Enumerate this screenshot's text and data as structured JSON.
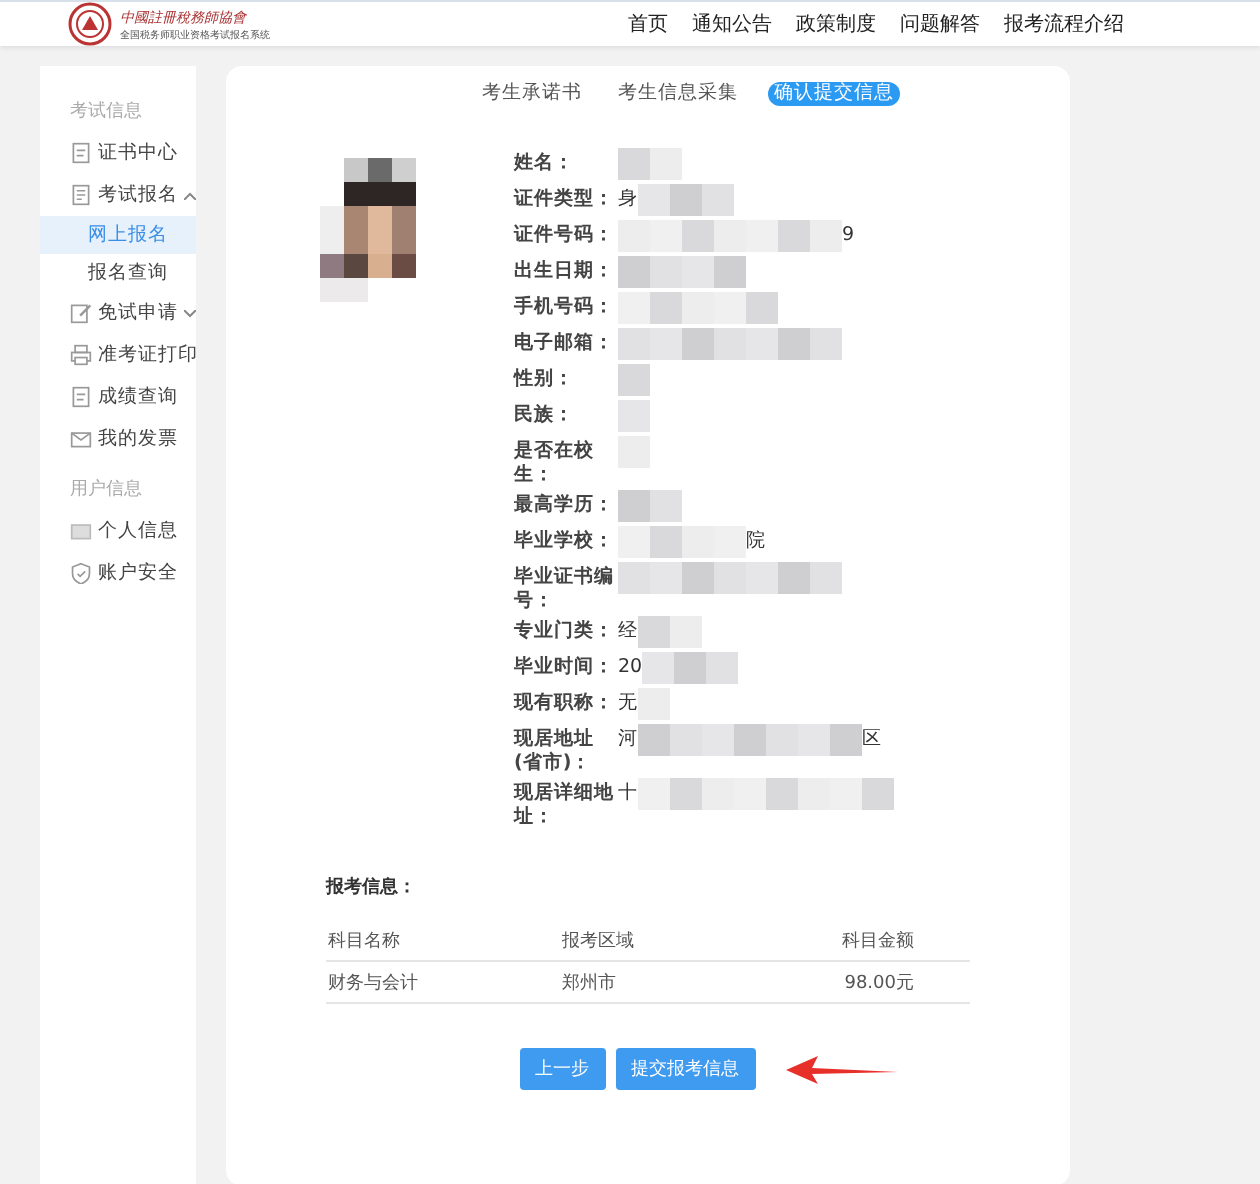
{
  "header": {
    "logo_title": "中國註冊稅務師協會",
    "logo_subtitle": "全国税务师职业资格考试报名系统",
    "nav": [
      {
        "label": "首页"
      },
      {
        "label": "通知公告"
      },
      {
        "label": "政策制度"
      },
      {
        "label": "问题解答"
      },
      {
        "label": "报考流程介绍"
      }
    ]
  },
  "sidebar": {
    "sections": [
      {
        "title": "考试信息",
        "items": [
          {
            "label": "证书中心"
          },
          {
            "label": "考试报名",
            "expanded": true,
            "children": [
              {
                "label": "网上报名",
                "selected": true
              },
              {
                "label": "报名查询",
                "selected": false
              }
            ]
          },
          {
            "label": "免试申请",
            "expanded": false
          },
          {
            "label": "准考证打印"
          },
          {
            "label": "成绩查询"
          },
          {
            "label": "我的发票"
          }
        ]
      },
      {
        "title": "用户信息",
        "items": [
          {
            "label": "个人信息"
          },
          {
            "label": "账户安全"
          }
        ]
      }
    ]
  },
  "steps": [
    {
      "label": "考生承诺书",
      "selected": false
    },
    {
      "label": "考生信息采集",
      "selected": false
    },
    {
      "label": "确认提交信息",
      "selected": true
    }
  ],
  "fields": [
    {
      "label": "姓名："
    },
    {
      "label": "证件类型：",
      "prefix": "身"
    },
    {
      "label": "证件号码：",
      "suffix": "9"
    },
    {
      "label": "出生日期："
    },
    {
      "label": "手机号码："
    },
    {
      "label": "电子邮箱："
    },
    {
      "label": "性别："
    },
    {
      "label": "民族："
    },
    {
      "label": "是否在校生："
    },
    {
      "label": "最高学历："
    },
    {
      "label": "毕业学校：",
      "suffix": "院"
    },
    {
      "label": "毕业证书编号："
    },
    {
      "label": "专业门类：",
      "prefix": "经"
    },
    {
      "label": "毕业时间：",
      "prefix": "20"
    },
    {
      "label": "现有职称：",
      "prefix": "无"
    },
    {
      "label": "现居地址(省市)：",
      "prefix": "河",
      "suffix": "区"
    },
    {
      "label": "现居详细地址：",
      "prefix": "十"
    }
  ],
  "exam": {
    "title": "报考信息：",
    "columns": [
      "科目名称",
      "报考区域",
      "科目金额"
    ],
    "rows": [
      [
        "财务与会计",
        "郑州市",
        "98.00元"
      ]
    ]
  },
  "buttons": [
    {
      "label": "上一步"
    },
    {
      "label": "提交报考信息"
    }
  ]
}
